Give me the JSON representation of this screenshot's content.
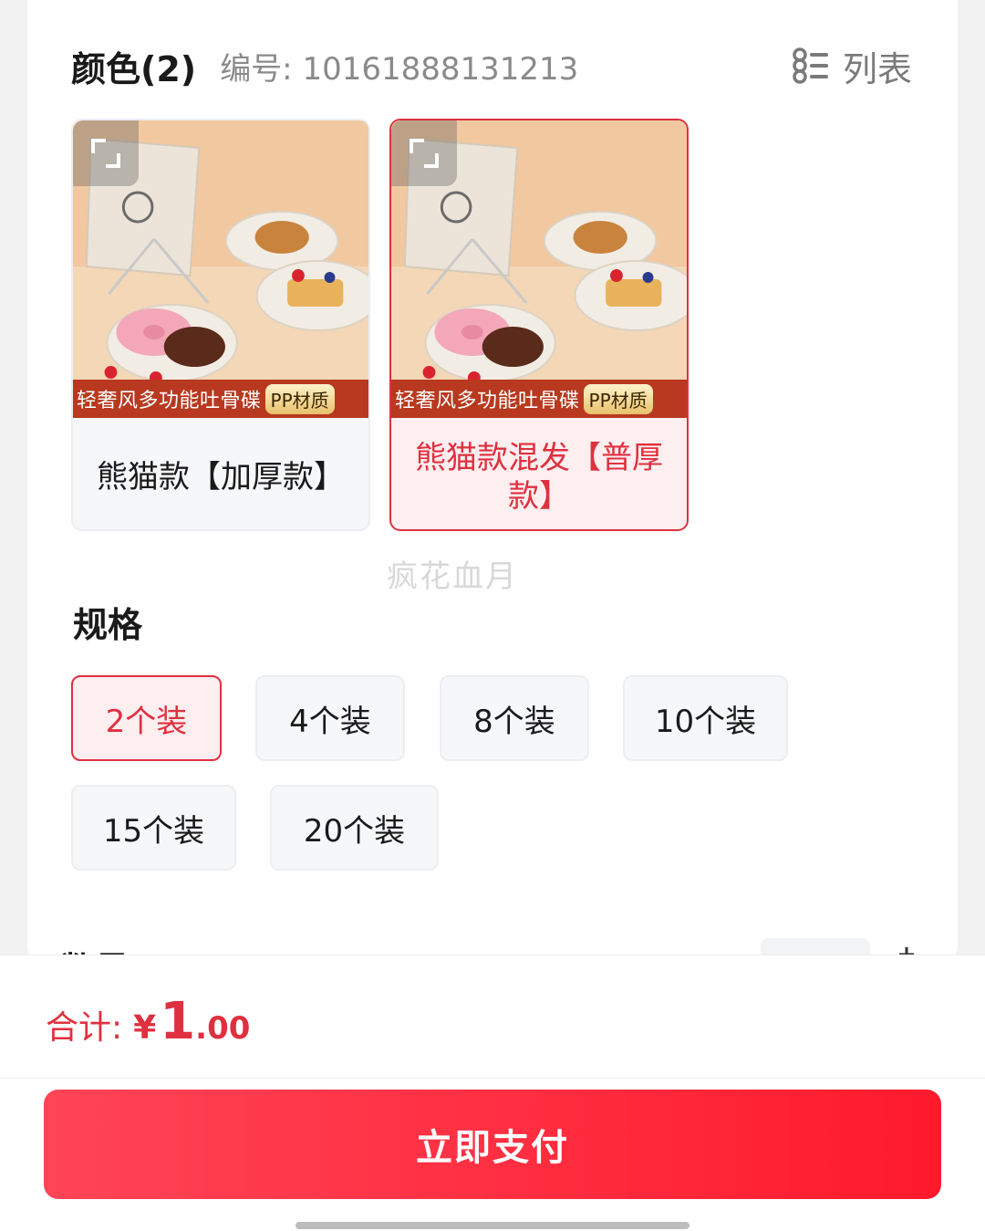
{
  "color_section": {
    "title": "颜色(2)",
    "sku_code": "编号: 10161888131213",
    "list_toggle_label": "列表"
  },
  "variants": [
    {
      "banner_text": "轻奢风多功能吐骨碟",
      "banner_tag": "PP材质",
      "name": "熊猫款【加厚款】",
      "selected": false
    },
    {
      "banner_text": "轻奢风多功能吐骨碟",
      "banner_tag": "PP材质",
      "name": "熊猫款混发【普厚款】",
      "selected": true
    }
  ],
  "watermark": "疯花血月",
  "spec_section": {
    "title": "规格",
    "options": [
      "2个装",
      "4个装",
      "8个装",
      "10个装",
      "15个装",
      "20个装"
    ],
    "selected": "2个装"
  },
  "quantity_section": {
    "label": "数量"
  },
  "footer": {
    "total_label": "合计:",
    "currency": "¥",
    "price_int": "1",
    "price_dec": ".00",
    "pay_button": "立即支付"
  },
  "colors": {
    "accent": "#e0303f",
    "button_start": "#ff4457",
    "button_end": "#ff1a2c"
  }
}
